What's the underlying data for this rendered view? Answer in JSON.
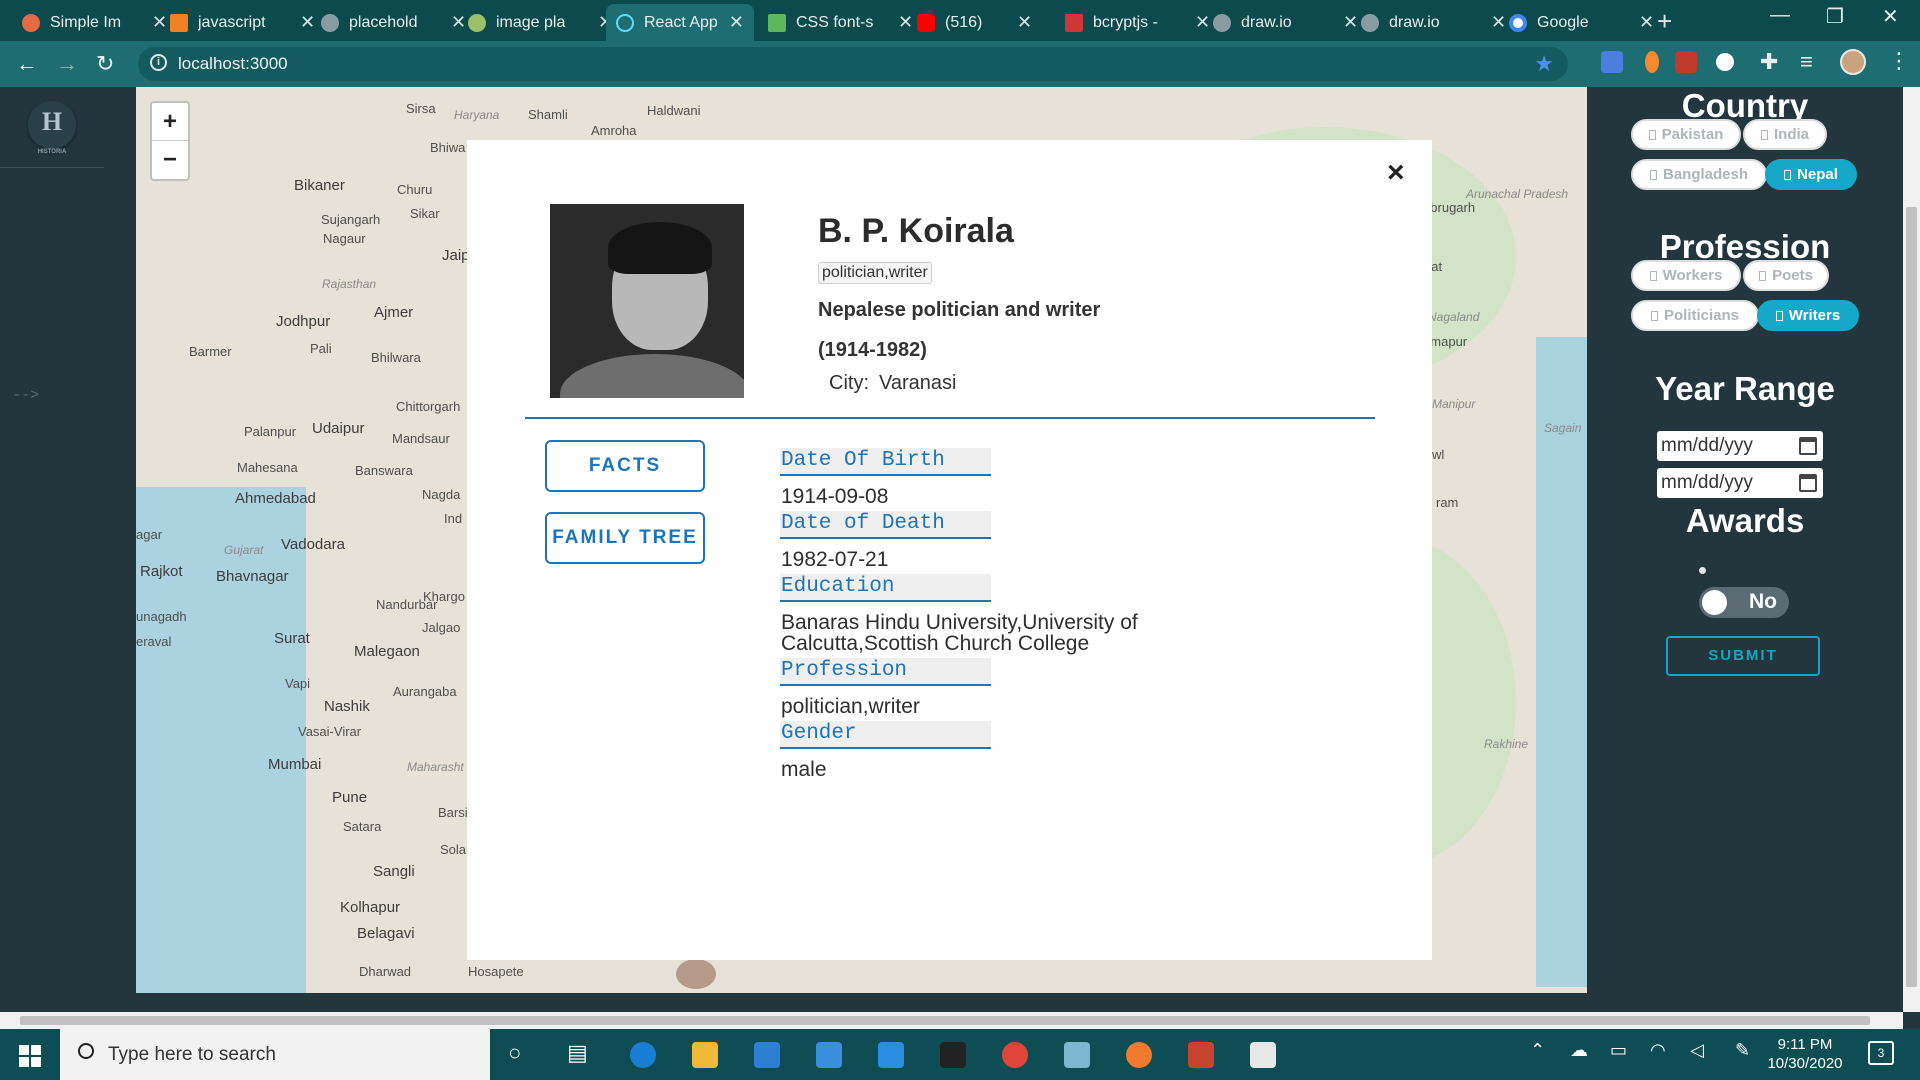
{
  "browser": {
    "tabs": [
      {
        "label": "Simple Im",
        "favicon_color": "#e26b46"
      },
      {
        "label": "javascript",
        "favicon_color": "#f48024"
      },
      {
        "label": "placehold",
        "favicon_color": "#8a9ca3"
      },
      {
        "label": "image pla",
        "favicon_color": "#9ac06a"
      },
      {
        "label": "React App",
        "favicon_color": "#61dafb",
        "active": true
      },
      {
        "label": "CSS font-s",
        "favicon_color": "#5cb85c"
      },
      {
        "label": "(516)",
        "favicon_color": "#ff0000"
      },
      {
        "label": "bcryptjs -",
        "favicon_color": "#cb3837"
      },
      {
        "label": "draw.io",
        "favicon_color": "#8a9ca3"
      },
      {
        "label": "draw.io",
        "favicon_color": "#8a9ca3"
      },
      {
        "label": "Google",
        "favicon_color": "#4285f4"
      }
    ],
    "url": "localhost:3000"
  },
  "sidebar": {
    "logo": "H",
    "logo_sub": "HISTORIA",
    "arrow": "-->"
  },
  "map": {
    "zoom_in": "+",
    "zoom_out": "−",
    "labels": [
      "Sirsa",
      "Haryana",
      "Shamli",
      "Haldwani",
      "Bikaner",
      "Churu",
      "Sujangarh",
      "Nagaur",
      "Sikar",
      "Jaip",
      "Rajasthan",
      "Jodhpur",
      "Ajmer",
      "Barmer",
      "Pali",
      "Bhilwara",
      "Chittorgarh",
      "Palanpur",
      "Udaipur",
      "Mandsaur",
      "Mahesana",
      "Banswara",
      "Ahmedabad",
      "Nagda",
      "Vadodara",
      "Gujarat",
      "Rajkot",
      "Bhavnagar",
      "Nandurbar",
      "Surat",
      "Malegaon",
      "Nashik",
      "Aurangaba",
      "Vasai-Virar",
      "Mumbai",
      "Maharasht",
      "Pune",
      "Satara",
      "Sangli",
      "Kolhapur",
      "Belagavi",
      "Dharwad",
      "Hosapete",
      "Sola",
      "Barsi",
      "Jalgao",
      "Khargo",
      "Ind",
      "Vapi",
      "agar",
      "unagadh",
      "eraval",
      "Amroha",
      "Bhiwa",
      "Dibrugarh",
      "Jorhat",
      "Dimapur",
      "Nagaland",
      "Manipur",
      "Arunachal Pradesh",
      "Rakhine",
      "Sagain",
      "wl",
      "ram"
    ]
  },
  "modal": {
    "close": "×",
    "name": "B. P. Koirala",
    "tag": "politician,writer",
    "description": "Nepalese politician and writer (1914-1982)",
    "city_label": "City:",
    "city": "Varanasi",
    "buttons": {
      "facts": "FACTS",
      "family_tree": "FAMILY TREE"
    },
    "facts": [
      {
        "key": "Date Of Birth",
        "value": "1914-09-08"
      },
      {
        "key": "Date of Death",
        "value": "1982-07-21"
      },
      {
        "key": "Education",
        "value": "Banaras Hindu University,University of Calcutta,Scottish Church College"
      },
      {
        "key": "Profession",
        "value": "politician,writer"
      },
      {
        "key": "Gender",
        "value": "male"
      }
    ]
  },
  "filters": {
    "country": {
      "heading": "Country",
      "options": [
        {
          "label": "Pakistan",
          "selected": false
        },
        {
          "label": "India",
          "selected": false
        },
        {
          "label": "Bangladesh",
          "selected": false
        },
        {
          "label": "Nepal",
          "selected": true
        }
      ]
    },
    "profession": {
      "heading": "Profession",
      "options": [
        {
          "label": "Workers",
          "selected": false
        },
        {
          "label": "Poets",
          "selected": false
        },
        {
          "label": "Politicians",
          "selected": false
        },
        {
          "label": "Writers",
          "selected": true
        }
      ]
    },
    "year_range": {
      "heading": "Year Range",
      "from_placeholder": "mm/dd/yyy",
      "to_placeholder": "mm/dd/yyy"
    },
    "awards": {
      "heading": "Awards",
      "toggle_label": "No",
      "value": false
    },
    "submit": "SUBMIT",
    "accent_color": "#15a8c8"
  },
  "taskbar": {
    "search_placeholder": "Type here to search",
    "time": "9:11 PM",
    "date": "10/30/2020",
    "notifications": "3"
  }
}
